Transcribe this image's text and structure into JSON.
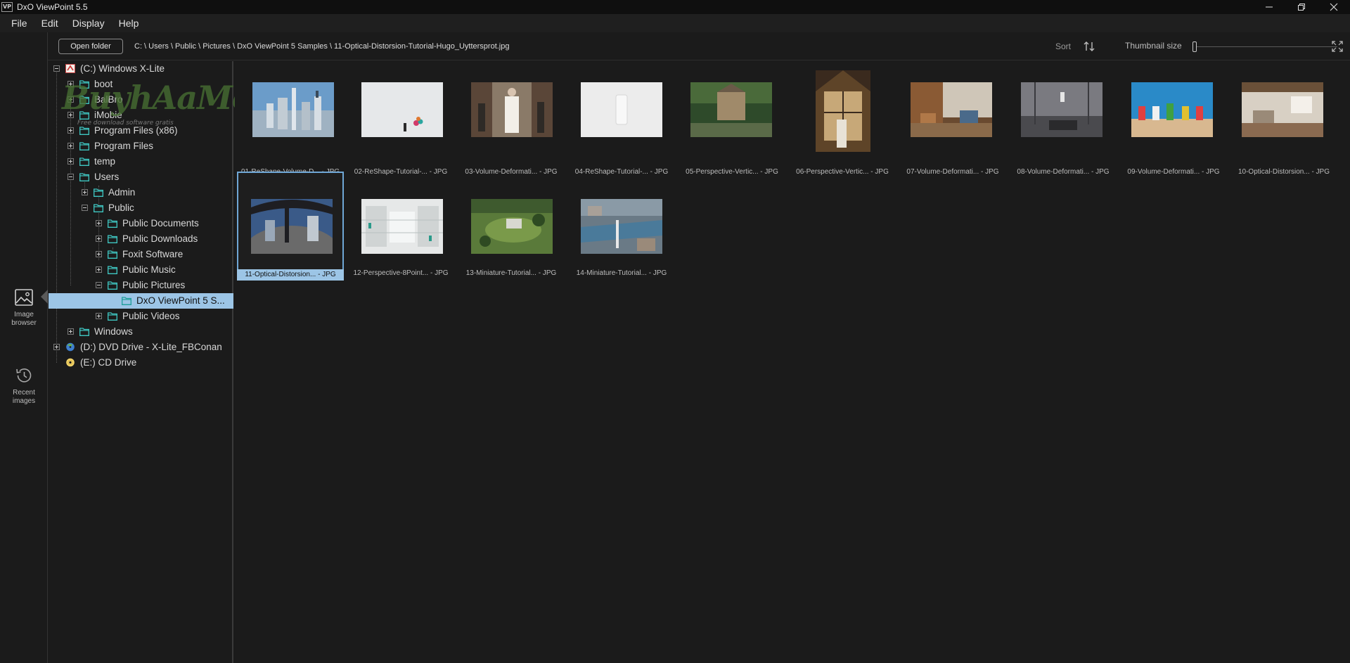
{
  "window": {
    "app_icon_text": "VP",
    "title": "DxO ViewPoint 5.5"
  },
  "menu": [
    "File",
    "Edit",
    "Display",
    "Help"
  ],
  "rail": {
    "image_browser": "Image browser",
    "recent_images": "Recent images"
  },
  "toolbar": {
    "open_folder": "Open folder",
    "path": "C: \\ Users \\ Public \\ Pictures \\ DxO ViewPoint 5 Samples \\ 11-Optical-Distorsion-Tutorial-Hugo_Uyttersprot.jpg",
    "sort_label": "Sort",
    "thumbnail_size_label": "Thumbnail size",
    "thumbnail_size_level": 0.0
  },
  "watermark": {
    "text": "BuyhAaMe",
    "sub": "Free download software gratis"
  },
  "tree": [
    {
      "label": "(C:) Windows X-Lite",
      "icon": "drive-c-icon",
      "name": "tree-drive-c"
    },
    {
      "label": "boot",
      "icon": "folder-icon",
      "name": "tree-folder-boot"
    },
    {
      "label": "BalBro",
      "icon": "folder-icon",
      "name": "tree-folder-balbro"
    },
    {
      "label": "iMobie",
      "icon": "folder-icon",
      "name": "tree-folder-imobie"
    },
    {
      "label": "Program Files (x86)",
      "icon": "folder-icon",
      "name": "tree-folder-program-files-x86"
    },
    {
      "label": "Program Files",
      "icon": "folder-icon",
      "name": "tree-folder-program-files"
    },
    {
      "label": "temp",
      "icon": "folder-icon",
      "name": "tree-folder-temp"
    },
    {
      "label": "Users",
      "icon": "folder-icon",
      "name": "tree-folder-users"
    },
    {
      "label": "Admin",
      "icon": "folder-icon",
      "name": "tree-folder-admin"
    },
    {
      "label": "Public",
      "icon": "folder-icon",
      "name": "tree-folder-public"
    },
    {
      "label": "Public Documents",
      "icon": "folder-icon",
      "name": "tree-folder-public-documents"
    },
    {
      "label": "Public Downloads",
      "icon": "folder-icon",
      "name": "tree-folder-public-downloads"
    },
    {
      "label": "Foxit Software",
      "icon": "folder-icon",
      "name": "tree-folder-foxit-software"
    },
    {
      "label": "Public Music",
      "icon": "folder-icon",
      "name": "tree-folder-public-music"
    },
    {
      "label": "Public Pictures",
      "icon": "folder-icon",
      "name": "tree-folder-public-pictures"
    },
    {
      "label": "DxO ViewPoint 5 S...",
      "icon": "folder-icon",
      "name": "tree-folder-dxo-viewpoint-samples"
    },
    {
      "label": "Public Videos",
      "icon": "folder-icon",
      "name": "tree-folder-public-videos"
    },
    {
      "label": "Windows",
      "icon": "folder-icon",
      "name": "tree-folder-windows"
    },
    {
      "label": "(D:) DVD Drive - X-Lite_FBConan",
      "icon": "dvd-drive-icon",
      "name": "tree-drive-d"
    },
    {
      "label": "(E:) CD Drive",
      "icon": "cd-drive-icon",
      "name": "tree-drive-e"
    }
  ],
  "thumbnails": [
    {
      "caption": "01-ReShape-Volume-D... - JPG"
    },
    {
      "caption": "02-ReShape-Tutorial-... - JPG"
    },
    {
      "caption": "03-Volume-Deformati... - JPG"
    },
    {
      "caption": "04-ReShape-Tutorial-... - JPG"
    },
    {
      "caption": "05-Perspective-Vertic... - JPG"
    },
    {
      "caption": "06-Perspective-Vertic... - JPG"
    },
    {
      "caption": "07-Volume-Deformati... - JPG"
    },
    {
      "caption": "08-Volume-Deformati... - JPG"
    },
    {
      "caption": "09-Volume-Deformati... - JPG"
    },
    {
      "caption": "10-Optical-Distorsion... - JPG"
    },
    {
      "caption": "11-Optical-Distorsion... - JPG"
    },
    {
      "caption": "12-Perspective-8Point... - JPG"
    },
    {
      "caption": "13-Miniature-Tutorial... - JPG"
    },
    {
      "caption": "14-Miniature-Tutorial... - JPG"
    }
  ],
  "colors": {
    "selection": "#9cc5e6",
    "selected_border": "#6fa7d6",
    "folder": "#3fc7c2",
    "background": "#1b1b1b"
  }
}
